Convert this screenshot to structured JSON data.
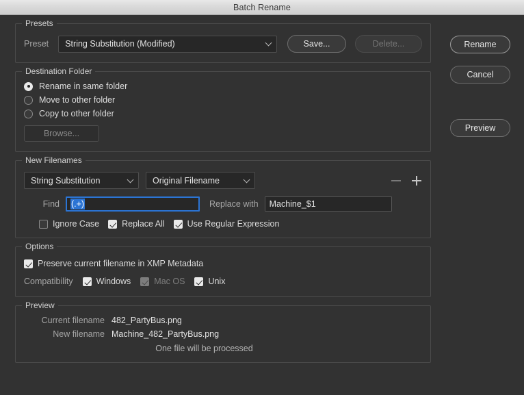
{
  "window": {
    "title": "Batch Rename"
  },
  "presets": {
    "group_title": "Presets",
    "preset_label": "Preset",
    "preset_value": "String Substitution (Modified)",
    "save_label": "Save...",
    "delete_label": "Delete..."
  },
  "destination": {
    "group_title": "Destination Folder",
    "options": [
      {
        "label": "Rename in same folder",
        "selected": true
      },
      {
        "label": "Move to other folder",
        "selected": false
      },
      {
        "label": "Copy to other folder",
        "selected": false
      }
    ],
    "browse_label": "Browse..."
  },
  "new_filenames": {
    "group_title": "New Filenames",
    "type_select": "String Substitution",
    "source_select": "Original Filename",
    "remove_icon": "minus-icon",
    "add_icon": "plus-icon",
    "find_label": "Find",
    "find_value": "(.+)",
    "replace_label": "Replace with",
    "replace_value": "Machine_$1",
    "checkboxes": [
      {
        "label": "Ignore Case",
        "checked": false
      },
      {
        "label": "Replace All",
        "checked": true
      },
      {
        "label": "Use Regular Expression",
        "checked": true
      }
    ]
  },
  "options": {
    "group_title": "Options",
    "preserve_label": "Preserve current filename in XMP Metadata",
    "preserve_checked": true,
    "compatibility_label": "Compatibility",
    "compatibility": [
      {
        "label": "Windows",
        "checked": true,
        "disabled": false
      },
      {
        "label": "Mac OS",
        "checked": true,
        "disabled": true
      },
      {
        "label": "Unix",
        "checked": true,
        "disabled": false
      }
    ]
  },
  "preview": {
    "group_title": "Preview",
    "current_label": "Current filename",
    "current_value": "482_PartyBus.png",
    "new_label": "New filename",
    "new_value": "Machine_482_PartyBus.png",
    "note": "One file will be processed"
  },
  "actions": {
    "rename_label": "Rename",
    "cancel_label": "Cancel",
    "preview_label": "Preview"
  },
  "colors": {
    "accent": "#2b74d4",
    "window_bg": "#323232",
    "field_bg": "#272727"
  }
}
